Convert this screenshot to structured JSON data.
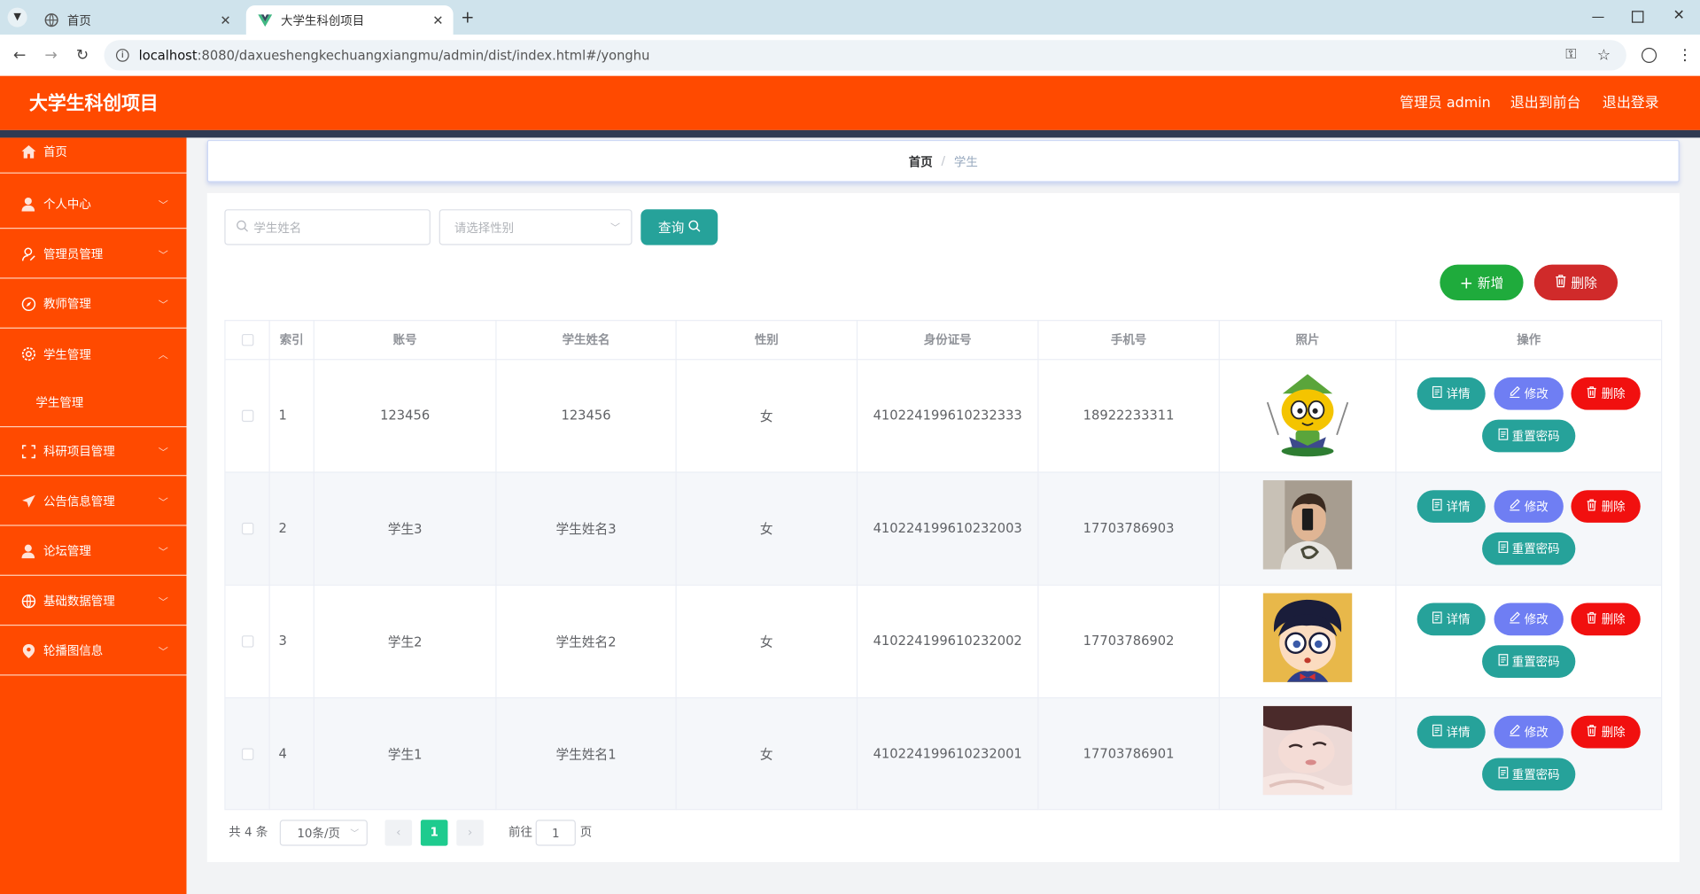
{
  "browser": {
    "tabs": [
      {
        "title": "首页"
      },
      {
        "title": "大学生科创项目"
      }
    ],
    "url_host": "localhost",
    "url_rest": ":8080/daxueshengkechuangxiangmu/admin/dist/index.html#/yonghu"
  },
  "header": {
    "title": "大学生科创项目",
    "admin": "管理员 admin",
    "front": "退出到前台",
    "logout": "退出登录"
  },
  "sidebar": {
    "items": [
      {
        "label": "首页",
        "icon": "home-icon"
      },
      {
        "label": "个人中心",
        "icon": "user-icon"
      },
      {
        "label": "管理员管理",
        "icon": "admin-icon"
      },
      {
        "label": "教师管理",
        "icon": "compass-icon"
      },
      {
        "label": "学生管理",
        "icon": "gear-icon"
      },
      {
        "label": "科研项目管理",
        "icon": "frame-icon"
      },
      {
        "label": "公告信息管理",
        "icon": "send-icon"
      },
      {
        "label": "论坛管理",
        "icon": "user-icon"
      },
      {
        "label": "基础数据管理",
        "icon": "globe-icon"
      },
      {
        "label": "轮播图信息",
        "icon": "location-icon"
      }
    ],
    "sub_item": "学生管理"
  },
  "breadcrumb": {
    "home": "首页",
    "sep": "/",
    "current": "学生"
  },
  "search": {
    "name_placeholder": "学生姓名",
    "gender_placeholder": "请选择性别",
    "query_label": "查询"
  },
  "toolbar": {
    "add_label": "新增",
    "delete_label": "删除"
  },
  "table": {
    "headers": [
      "索引",
      "账号",
      "学生姓名",
      "性别",
      "身份证号",
      "手机号",
      "照片",
      "操作"
    ],
    "rows": [
      {
        "index": "1",
        "account": "123456",
        "name": "123456",
        "gender": "女",
        "id_card": "410224199610232333",
        "phone": "18922233311"
      },
      {
        "index": "2",
        "account": "学生3",
        "name": "学生姓名3",
        "gender": "女",
        "id_card": "410224199610232003",
        "phone": "17703786903"
      },
      {
        "index": "3",
        "account": "学生2",
        "name": "学生姓名2",
        "gender": "女",
        "id_card": "410224199610232002",
        "phone": "17703786902"
      },
      {
        "index": "4",
        "account": "学生1",
        "name": "学生姓名1",
        "gender": "女",
        "id_card": "410224199610232001",
        "phone": "17703786901"
      }
    ],
    "actions": {
      "detail": "详情",
      "edit": "修改",
      "delete": "删除",
      "reset": "重置密码"
    }
  },
  "pagination": {
    "total": "共 4 条",
    "page_size": "10条/页",
    "current_page": "1",
    "goto_prefix": "前往",
    "goto_value": "1",
    "goto_suffix": "页"
  },
  "colors": {
    "brand": "#ff4a00",
    "teal": "#26a29a",
    "purple": "#6f7ef3",
    "red": "#f1100f",
    "green": "#1fab3c",
    "dark_red": "#d02a2a"
  }
}
